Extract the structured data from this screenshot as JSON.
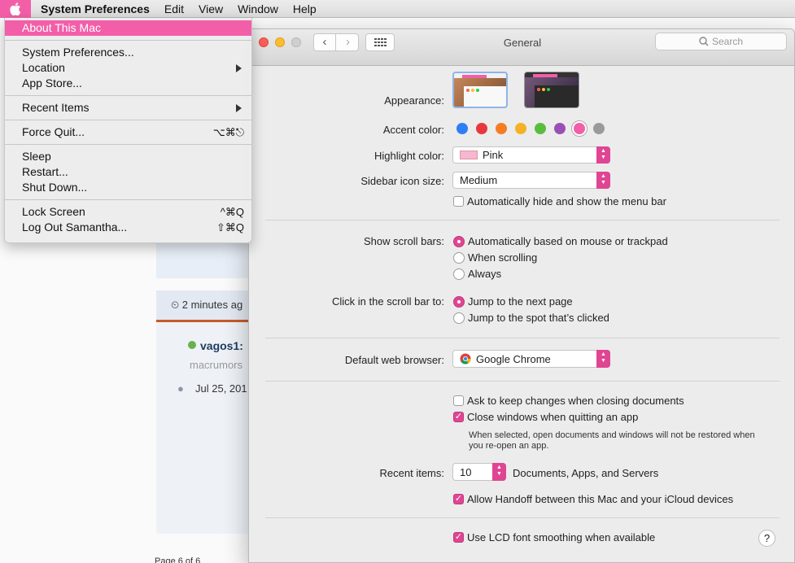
{
  "menubar": {
    "app_name": "System Preferences",
    "items": [
      "Edit",
      "View",
      "Window",
      "Help"
    ]
  },
  "apple_menu": {
    "items": [
      {
        "label": "About This Mac",
        "shortcut": "",
        "highlighted": true
      },
      {
        "label": "System Preferences...",
        "shortcut": ""
      },
      {
        "label": "Location",
        "shortcut": "",
        "submenu": true
      },
      {
        "label": "App Store...",
        "shortcut": ""
      },
      {
        "label": "Recent Items",
        "shortcut": "",
        "submenu": true
      },
      {
        "label": "Force Quit...",
        "shortcut": "⌥⌘⎋"
      },
      {
        "label": "Sleep",
        "shortcut": ""
      },
      {
        "label": "Restart...",
        "shortcut": ""
      },
      {
        "label": "Shut Down...",
        "shortcut": ""
      },
      {
        "label": "Lock Screen",
        "shortcut": "^⌘Q"
      },
      {
        "label": "Log Out Samantha...",
        "shortcut": "⇧⌘Q"
      }
    ]
  },
  "window": {
    "title": "General",
    "search_placeholder": "Search"
  },
  "prefs": {
    "appearance_label": "Appearance:",
    "accent_label": "Accent color:",
    "accent_colors": [
      "#2f7ef6",
      "#e8383d",
      "#f47d23",
      "#f5b224",
      "#5bbd3f",
      "#9a4fb6",
      "#f25fa8",
      "#9a9a9a"
    ],
    "highlight_label": "Highlight color:",
    "highlight_value": "Pink",
    "sidebar_label": "Sidebar icon size:",
    "sidebar_value": "Medium",
    "autohide_menubar": "Automatically hide and show the menu bar",
    "scrollbars_label": "Show scroll bars:",
    "scroll_opts": [
      "Automatically based on mouse or trackpad",
      "When scrolling",
      "Always"
    ],
    "click_label": "Click in the scroll bar to:",
    "click_opts": [
      "Jump to the next page",
      "Jump to the spot that’s clicked"
    ],
    "browser_label": "Default web browser:",
    "browser_value": "Google Chrome",
    "ask_keep": "Ask to keep changes when closing documents",
    "close_windows": "Close windows when quitting an app",
    "note": "When selected, open documents and windows will not be restored when you re-open an app.",
    "recent_label": "Recent items:",
    "recent_value": "10",
    "recent_suffix": "Documents, Apps, and Servers",
    "handoff": "Allow Handoff between this Mac and your iCloud devices",
    "lcd": "Use LCD font smoothing when available",
    "help": "?"
  },
  "background": {
    "time": "2 minutes ag",
    "user": "vagos1:",
    "role": "macrumors",
    "date": "Jul 25, 201",
    "pager": "Page 6 of 6"
  }
}
